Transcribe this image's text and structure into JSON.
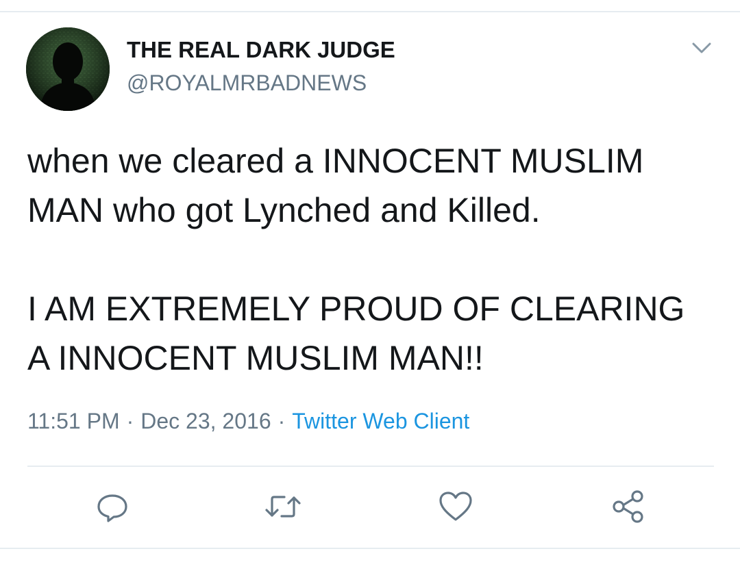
{
  "tweet": {
    "display_name": "THE REAL DARK JUDGE",
    "handle": "@ROYALMRBADNEWS",
    "text": "when we cleared a INNOCENT MUSLIM\nMAN who got Lynched and Killed.\n\nI AM EXTREMELY PROUD OF CLEARING\nA INNOCENT MUSLIM MAN!!",
    "time": "11:51 PM",
    "date": "Dec 23, 2016",
    "separator": "·",
    "source": "Twitter Web Client"
  },
  "icons": {
    "caret": "chevron-down-icon",
    "reply": "reply-icon",
    "retweet": "retweet-icon",
    "like": "heart-icon",
    "share": "share-icon"
  },
  "colors": {
    "text": "#14171a",
    "secondary": "#657786",
    "link": "#1b95e0",
    "divider": "#e6ecf0"
  }
}
